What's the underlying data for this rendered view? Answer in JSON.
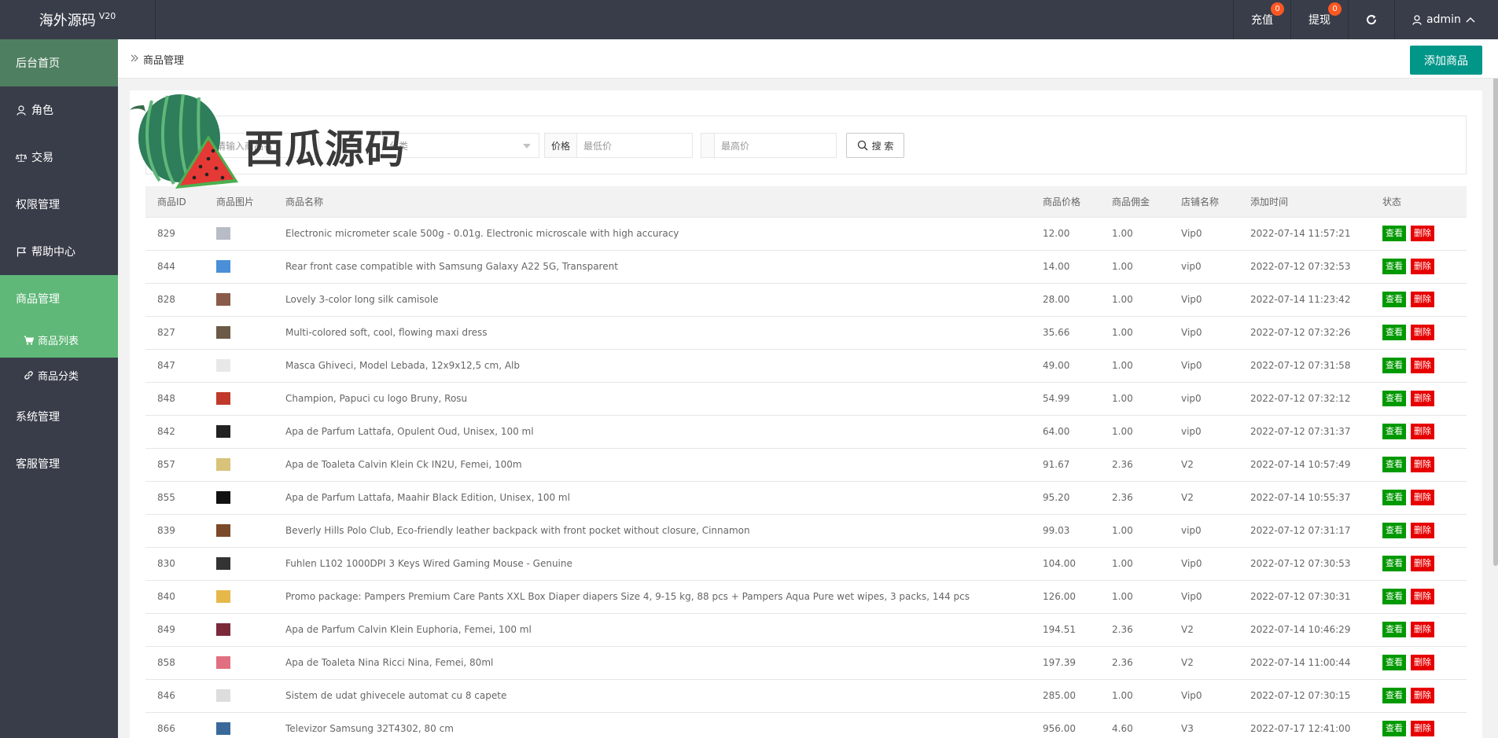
{
  "topbar": {
    "brand": "海外源码",
    "version": "V20",
    "recharge_label": "充值",
    "recharge_badge": "0",
    "withdraw_label": "提现",
    "withdraw_badge": "0",
    "user_label": "admin"
  },
  "sidebar": {
    "items": [
      {
        "label": "后台首页",
        "icon": "home"
      },
      {
        "label": "角色",
        "icon": "user-icon"
      },
      {
        "label": "交易",
        "icon": "scale-icon"
      },
      {
        "label": "权限管理",
        "icon": ""
      },
      {
        "label": "帮助中心",
        "icon": "flag-icon"
      },
      {
        "label": "商品管理",
        "icon": ""
      }
    ],
    "sub_items": [
      {
        "label": "商品列表",
        "icon": "cart-icon"
      },
      {
        "label": "商品分类",
        "icon": "link-icon"
      }
    ],
    "bottom_items": [
      {
        "label": "系统管理"
      },
      {
        "label": "客服管理"
      }
    ]
  },
  "breadcrumb": {
    "current": "商品管理",
    "add_button": "添加商品"
  },
  "filters": {
    "keyword_placeholder": "请输入商品名",
    "category_placeholder": "分类",
    "price_label": "价格",
    "min_placeholder": "最低价",
    "max_placeholder": "最高价",
    "search_label": "搜 索"
  },
  "watermark": "西瓜源码",
  "table": {
    "headers": [
      "商品ID",
      "商品图片",
      "商品名称",
      "商品价格",
      "商品佣金",
      "店铺名称",
      "添加时间",
      "状态"
    ],
    "view_label": "查看",
    "delete_label": "删除",
    "rows": [
      {
        "id": "829",
        "name": "Electronic micrometer scale 500g - 0.01g. Electronic microscale with high accuracy",
        "price": "12.00",
        "commission": "1.00",
        "shop": "Vip0",
        "time": "2022-07-14 11:57:21",
        "thumb": "#b8bcc6"
      },
      {
        "id": "844",
        "name": "Rear front case compatible with Samsung Galaxy A22 5G, Transparent",
        "price": "14.00",
        "commission": "1.00",
        "shop": "vip0",
        "time": "2022-07-12 07:32:53",
        "thumb": "#4a8fd8"
      },
      {
        "id": "828",
        "name": "Lovely 3-color long silk camisole",
        "price": "28.00",
        "commission": "1.00",
        "shop": "Vip0",
        "time": "2022-07-14 11:23:42",
        "thumb": "#8a5a4a"
      },
      {
        "id": "827",
        "name": "Multi-colored soft, cool, flowing maxi dress",
        "price": "35.66",
        "commission": "1.00",
        "shop": "Vip0",
        "time": "2022-07-12 07:32:26",
        "thumb": "#6b5a48"
      },
      {
        "id": "847",
        "name": "Masca Ghiveci, Model Lebada, 12x9x12,5 cm, Alb",
        "price": "49.00",
        "commission": "1.00",
        "shop": "Vip0",
        "time": "2022-07-12 07:31:58",
        "thumb": "#e8e8e8"
      },
      {
        "id": "848",
        "name": "Champion, Papuci cu logo Bruny, Rosu",
        "price": "54.99",
        "commission": "1.00",
        "shop": "vip0",
        "time": "2022-07-12 07:32:12",
        "thumb": "#c0392b"
      },
      {
        "id": "842",
        "name": "Apa de Parfum Lattafa, Opulent Oud, Unisex, 100 ml",
        "price": "64.00",
        "commission": "1.00",
        "shop": "vip0",
        "time": "2022-07-12 07:31:37",
        "thumb": "#222222"
      },
      {
        "id": "857",
        "name": "Apa de Toaleta Calvin Klein Ck IN2U, Femei, 100m",
        "price": "91.67",
        "commission": "2.36",
        "shop": "V2",
        "time": "2022-07-14 10:57:49",
        "thumb": "#d9c27a"
      },
      {
        "id": "855",
        "name": "Apa de Parfum Lattafa, Maahir Black Edition, Unisex, 100 ml",
        "price": "95.20",
        "commission": "2.36",
        "shop": "V2",
        "time": "2022-07-14 10:55:37",
        "thumb": "#111111"
      },
      {
        "id": "839",
        "name": "Beverly Hills Polo Club, Eco-friendly leather backpack with front pocket without closure, Cinnamon",
        "price": "99.03",
        "commission": "1.00",
        "shop": "vip0",
        "time": "2022-07-12 07:31:17",
        "thumb": "#7a4a2a"
      },
      {
        "id": "830",
        "name": "Fuhlen L102 1000DPI 3 Keys Wired Gaming Mouse - Genuine",
        "price": "104.00",
        "commission": "1.00",
        "shop": "Vip0",
        "time": "2022-07-12 07:30:53",
        "thumb": "#333333"
      },
      {
        "id": "840",
        "name": "Promo package: Pampers Premium Care Pants XXL Box Diaper diapers Size 4, 9-15 kg, 88 pcs + Pampers Aqua Pure wet wipes, 3 packs, 144 pcs",
        "price": "126.00",
        "commission": "1.00",
        "shop": "Vip0",
        "time": "2022-07-12 07:30:31",
        "thumb": "#e6b84a"
      },
      {
        "id": "849",
        "name": "Apa de Parfum Calvin Klein Euphoria, Femei, 100 ml",
        "price": "194.51",
        "commission": "2.36",
        "shop": "V2",
        "time": "2022-07-14 10:46:29",
        "thumb": "#7a2a3a"
      },
      {
        "id": "858",
        "name": "Apa de Toaleta Nina Ricci Nina, Femei, 80ml",
        "price": "197.39",
        "commission": "2.36",
        "shop": "V2",
        "time": "2022-07-14 11:00:44",
        "thumb": "#e07080"
      },
      {
        "id": "846",
        "name": "Sistem de udat ghivecele automat cu 8 capete",
        "price": "285.00",
        "commission": "1.00",
        "shop": "Vip0",
        "time": "2022-07-12 07:30:15",
        "thumb": "#dddddd"
      },
      {
        "id": "866",
        "name": "Televizor Samsung 32T4302, 80 cm",
        "price": "956.00",
        "commission": "4.60",
        "shop": "V3",
        "time": "2022-07-17 12:41:00",
        "thumb": "#3a6a9a"
      }
    ]
  }
}
